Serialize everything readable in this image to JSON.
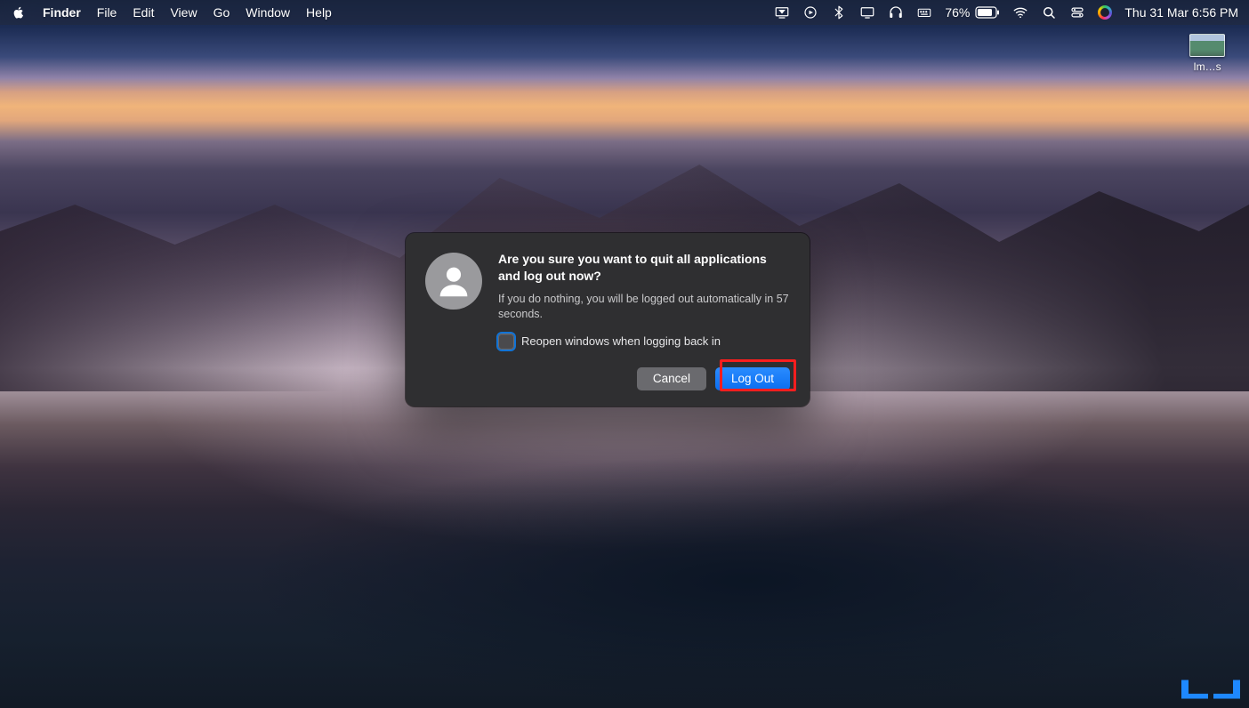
{
  "menubar": {
    "app_name": "Finder",
    "items": [
      "File",
      "Edit",
      "View",
      "Go",
      "Window",
      "Help"
    ],
    "battery_percent": "76%",
    "clock": "Thu 31 Mar  6:56 PM"
  },
  "desktop_icon": {
    "label": "Im…s"
  },
  "dialog": {
    "title": "Are you sure you want to quit all applications and log out now?",
    "message": "If you do nothing, you will be logged out automatically in 57 seconds.",
    "checkbox_label": "Reopen windows when logging back in",
    "cancel_label": "Cancel",
    "logout_label": "Log Out"
  }
}
